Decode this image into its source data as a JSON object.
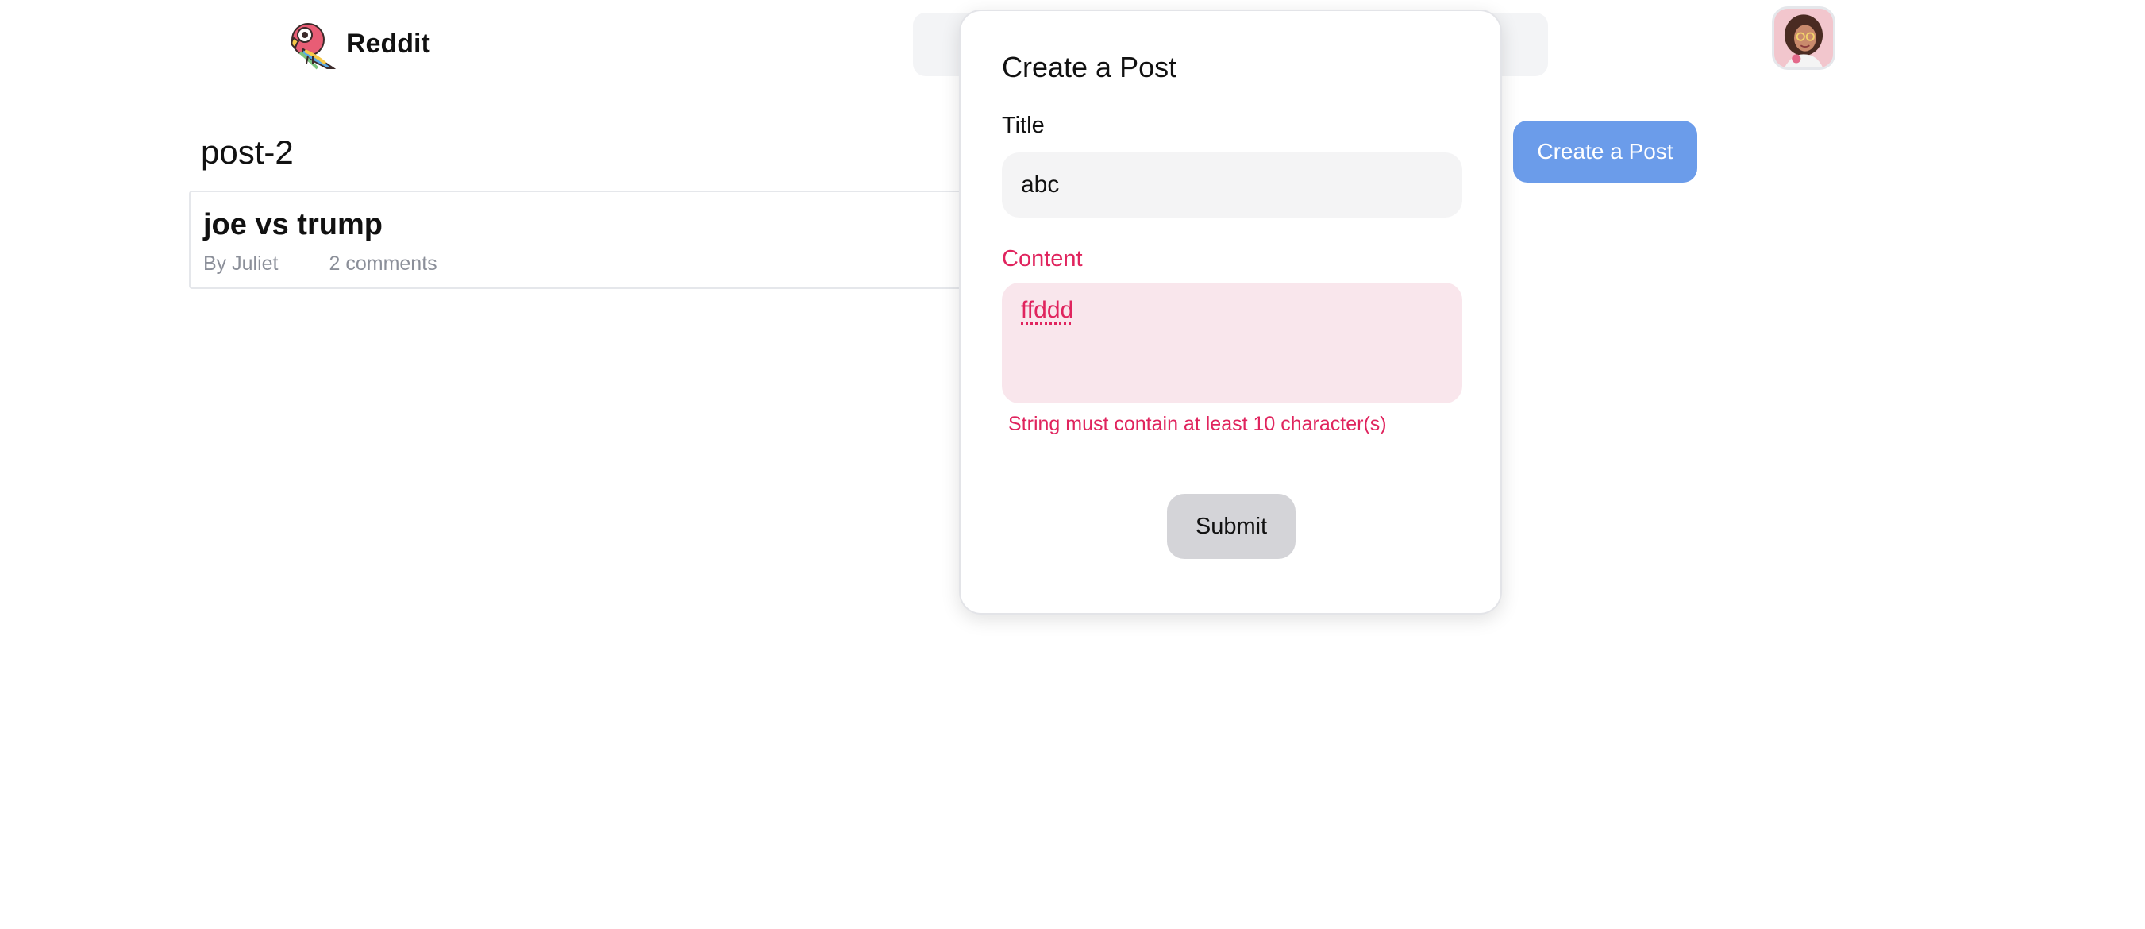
{
  "header": {
    "brand": "Reddit",
    "logo_icon": "parrot-icon",
    "avatar_icon": "user-avatar"
  },
  "main": {
    "channel_title": "post-2",
    "posts": [
      {
        "title": "joe vs trump",
        "author": "By Juliet",
        "comments": "2 comments"
      }
    ],
    "create_button_label": "Create a Post"
  },
  "modal": {
    "title": "Create a Post",
    "title_label": "Title",
    "title_value": "abc",
    "content_label": "Content",
    "content_value": "ffddd",
    "error": "String must contain at least 10 character(s)",
    "submit_label": "Submit"
  },
  "colors": {
    "accent_blue": "#6b9cea",
    "error_red": "#e0245e",
    "error_bg": "#f9e6ec",
    "input_bg": "#f4f4f5",
    "button_gray": "#d4d4d8"
  }
}
